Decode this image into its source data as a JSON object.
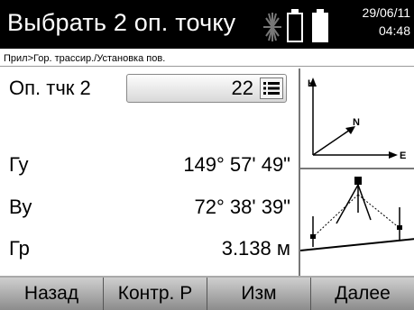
{
  "header": {
    "title": "Выбрать 2 оп. точку",
    "date": "29/06/11",
    "time": "04:48",
    "icons": [
      "laser-icon",
      "battery-icon",
      "battery-icon"
    ]
  },
  "breadcrumb": "Прил>Гор. трассир./Установка пов.",
  "fields": {
    "point_label": "Оп. тчк 2",
    "point_value": "22",
    "hz_label": "Гу",
    "hz_value": "149° 57' 49\"",
    "v_label": "Ву",
    "v_value": "72° 38' 39\"",
    "dist_label": "Гр",
    "dist_value": "3.138 м"
  },
  "diagram": {
    "axis_h": "H",
    "axis_n": "N",
    "axis_e": "E"
  },
  "softkeys": {
    "back": "Назад",
    "check": "Контр. Р",
    "measure": "Изм",
    "next": "Далее"
  }
}
